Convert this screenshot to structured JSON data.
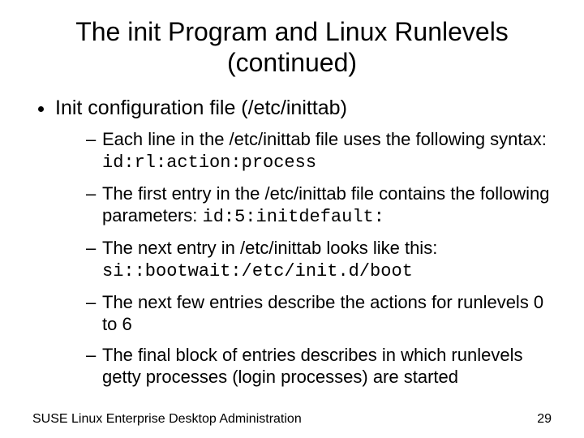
{
  "title_line1": "The init Program and Linux Runlevels",
  "title_line2": "(continued)",
  "bullet1": "Init configuration file (/etc/inittab)",
  "sub1_a": "Each line in the /etc/inittab file uses the following syntax: ",
  "sub1_b": "id:rl:action:process",
  "sub2_a": "The first entry in the /etc/inittab file contains the following parameters: ",
  "sub2_b": "id:5:initdefault:",
  "sub3_a": "The next entry in /etc/inittab looks like this: ",
  "sub3_b": "si::bootwait:/etc/init.d/boot",
  "sub4": "The next few entries describe the actions for runlevels 0 to 6",
  "sub5": "The final block of entries describes in which runlevels getty processes (login processes) are started",
  "footer_left": "SUSE Linux Enterprise Desktop Administration",
  "footer_right": "29"
}
